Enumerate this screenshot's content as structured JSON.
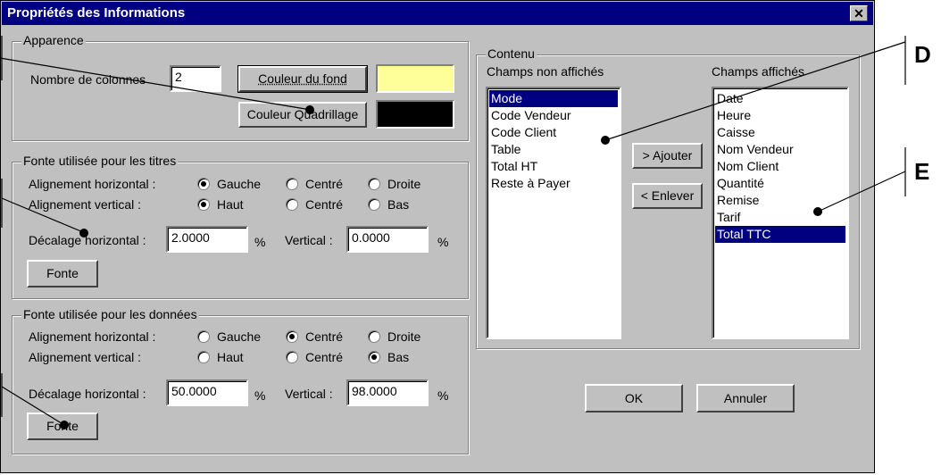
{
  "window": {
    "title": "Propriétés des Informations",
    "close_glyph": "✕"
  },
  "apparence": {
    "legend": "Apparence",
    "columns_label": "Nombre de colonnes",
    "columns_value": "2",
    "background_button": "Couleur du fond",
    "background_color": "#ffff99",
    "grid_button": "Couleur Quadrillage",
    "grid_color": "#000000"
  },
  "titles_font": {
    "legend": "Fonte utilisée pour les titres",
    "h_align_label": "Alignement horizontal :",
    "v_align_label": "Alignement vertical :",
    "h_options": [
      "Gauche",
      "Centré",
      "Droite"
    ],
    "h_selected": "Gauche",
    "v_options": [
      "Haut",
      "Centré",
      "Bas"
    ],
    "v_selected": "Haut",
    "h_offset_label": "Décalage horizontal :",
    "h_offset_value": "2.0000",
    "percent": "%",
    "vertical_label": "Vertical :",
    "vertical_value": "0.0000",
    "font_button": "Fonte"
  },
  "data_font": {
    "legend": "Fonte utilisée pour les données",
    "h_align_label": "Alignement horizontal :",
    "v_align_label": "Alignement vertical :",
    "h_options": [
      "Gauche",
      "Centré",
      "Droite"
    ],
    "h_selected": "Centré",
    "v_options": [
      "Haut",
      "Centré",
      "Bas"
    ],
    "v_selected": "Bas",
    "h_offset_label": "Décalage horizontal :",
    "h_offset_value": "50.0000",
    "percent": "%",
    "vertical_label": "Vertical :",
    "vertical_value": "98.0000",
    "font_button": "Fonte"
  },
  "contenu": {
    "legend": "Contenu",
    "hidden_label": "Champs non affichés",
    "hidden_items": [
      "Mode",
      "Code Vendeur",
      "Code Client",
      "Table",
      "Total HT",
      "Reste à Payer"
    ],
    "hidden_selected": "Mode",
    "shown_label": "Champs affichés",
    "shown_items": [
      "Date",
      "Heure",
      "Caisse",
      "Nom Vendeur",
      "Nom Client",
      "Quantité",
      "Remise",
      "Tarif",
      "Total TTC"
    ],
    "shown_selected": "Total TTC",
    "add_button": "> Ajouter",
    "remove_button": "< Enlever"
  },
  "footer": {
    "ok_button": "OK",
    "cancel_button": "Annuler"
  },
  "callouts": {
    "d": "D",
    "e": "E"
  }
}
